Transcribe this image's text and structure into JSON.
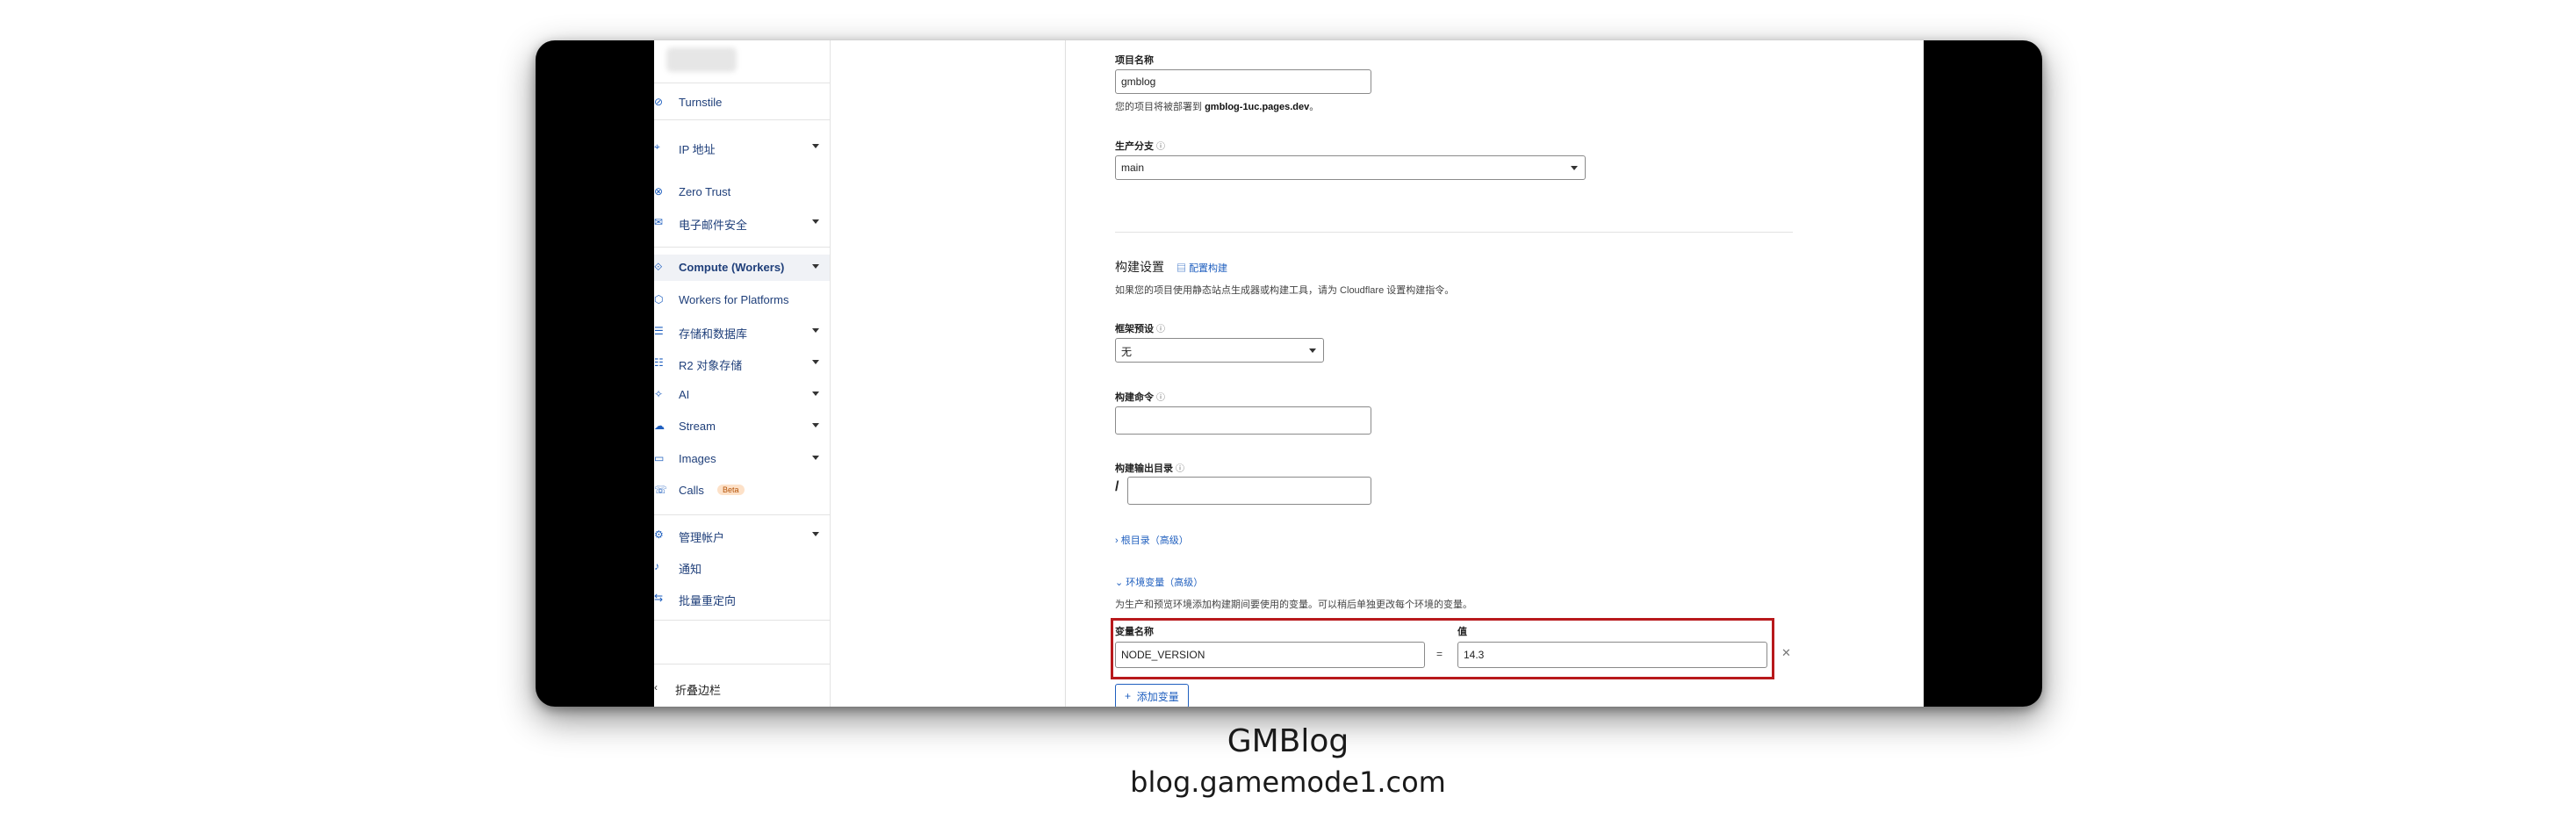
{
  "sidebar": {
    "items": [
      {
        "label": "Turnstile",
        "icon": "turnstile-icon",
        "caret": false
      },
      {
        "label": "IP 地址",
        "icon": "location-pin-icon",
        "caret": true
      },
      {
        "label": "Zero Trust",
        "icon": "zero-trust-icon",
        "caret": false
      },
      {
        "label": "电子邮件安全",
        "icon": "email-icon",
        "caret": true
      },
      {
        "label": "Compute (Workers)",
        "icon": "workers-icon",
        "caret": true,
        "active": true
      },
      {
        "label": "Workers for Platforms",
        "icon": "workers-platforms-icon",
        "caret": false
      },
      {
        "label": "存储和数据库",
        "icon": "database-icon",
        "caret": true
      },
      {
        "label": "R2 对象存储",
        "icon": "storage-icon",
        "caret": true
      },
      {
        "label": "AI",
        "icon": "ai-sparkle-icon",
        "caret": true
      },
      {
        "label": "Stream",
        "icon": "cloud-icon",
        "caret": true
      },
      {
        "label": "Images",
        "icon": "image-icon",
        "caret": true
      },
      {
        "label": "Calls",
        "icon": "phone-icon",
        "caret": false,
        "badge": "Beta"
      },
      {
        "label": "管理帐户",
        "icon": "gear-icon",
        "caret": true
      },
      {
        "label": "通知",
        "icon": "bell-icon",
        "caret": false
      },
      {
        "label": "批量重定向",
        "icon": "redirect-icon",
        "caret": false
      }
    ],
    "collapse_label": "折叠边栏"
  },
  "form": {
    "project_name_label": "项目名称",
    "project_name_value": "gmblog",
    "deploy_help_prefix": "您的项目将被部署到",
    "deploy_help_domain": "gmblog-1uc.pages.dev",
    "deploy_help_suffix": "。",
    "branch_label": "生产分支",
    "branch_value": "main",
    "build_title": "构建设置",
    "build_link": "配置构建",
    "build_desc": "如果您的项目使用静态站点生成器或构建工具，请为 Cloudflare 设置构建指令。",
    "preset_label": "框架预设",
    "preset_value": "无",
    "command_label": "构建命令",
    "command_value": "",
    "output_label": "构建输出目录",
    "output_prefix": "/",
    "output_value": "",
    "root_toggle": "根目录（高级）",
    "env_toggle": "环境变量（高级）",
    "env_desc": "为生产和预览环境添加构建期间要使用的变量。可以稍后单独更改每个环境的变量。",
    "var_name_label": "变量名称",
    "var_value_label": "值",
    "var_name": "NODE_VERSION",
    "equals": "=",
    "var_value": "14.3",
    "add_var_button": "添加变量"
  },
  "caption": {
    "title": "GMBlog",
    "url": "blog.gamemode1.com"
  },
  "colors": {
    "highlight": "#b8191c",
    "link": "#1f5fbf",
    "frame": "#000000"
  }
}
